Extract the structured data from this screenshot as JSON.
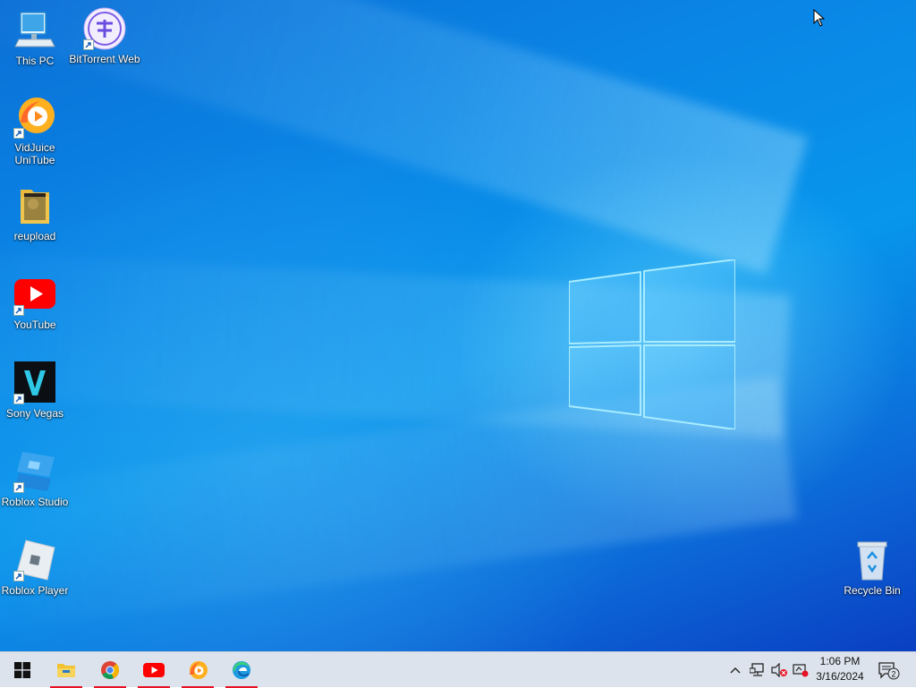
{
  "desktop": {
    "icons": [
      {
        "label": "This PC"
      },
      {
        "label": "BitTorrent Web"
      },
      {
        "label": "VidJuice UniTube"
      },
      {
        "label": "reupload"
      },
      {
        "label": "YouTube"
      },
      {
        "label": "Sony Vegas"
      },
      {
        "label": "Roblox Studio"
      },
      {
        "label": "Roblox Player"
      },
      {
        "label": "Recycle Bin"
      }
    ]
  },
  "taskbar": {
    "start_icon": "windows-logo-icon",
    "pinned": [
      {
        "name": "File Explorer",
        "icon": "folder-icon",
        "running": true
      },
      {
        "name": "Google Chrome",
        "icon": "chrome-icon",
        "running": true
      },
      {
        "name": "YouTube",
        "icon": "youtube-icon",
        "running": true
      },
      {
        "name": "VidJuice UniTube",
        "icon": "unitube-icon",
        "running": true
      },
      {
        "name": "Microsoft Edge",
        "icon": "edge-icon",
        "running": true
      }
    ],
    "tray": {
      "icons": [
        "chevron-up-icon",
        "network-icon",
        "volume-muted-icon",
        "security-alert-icon"
      ],
      "time": "1:06 PM",
      "date": "3/16/2024",
      "notification_count": "2"
    }
  },
  "colors": {
    "accent_running": "#e81123",
    "taskbar": "#dce3ec",
    "wallpaper_blue": "#0a86e6"
  }
}
